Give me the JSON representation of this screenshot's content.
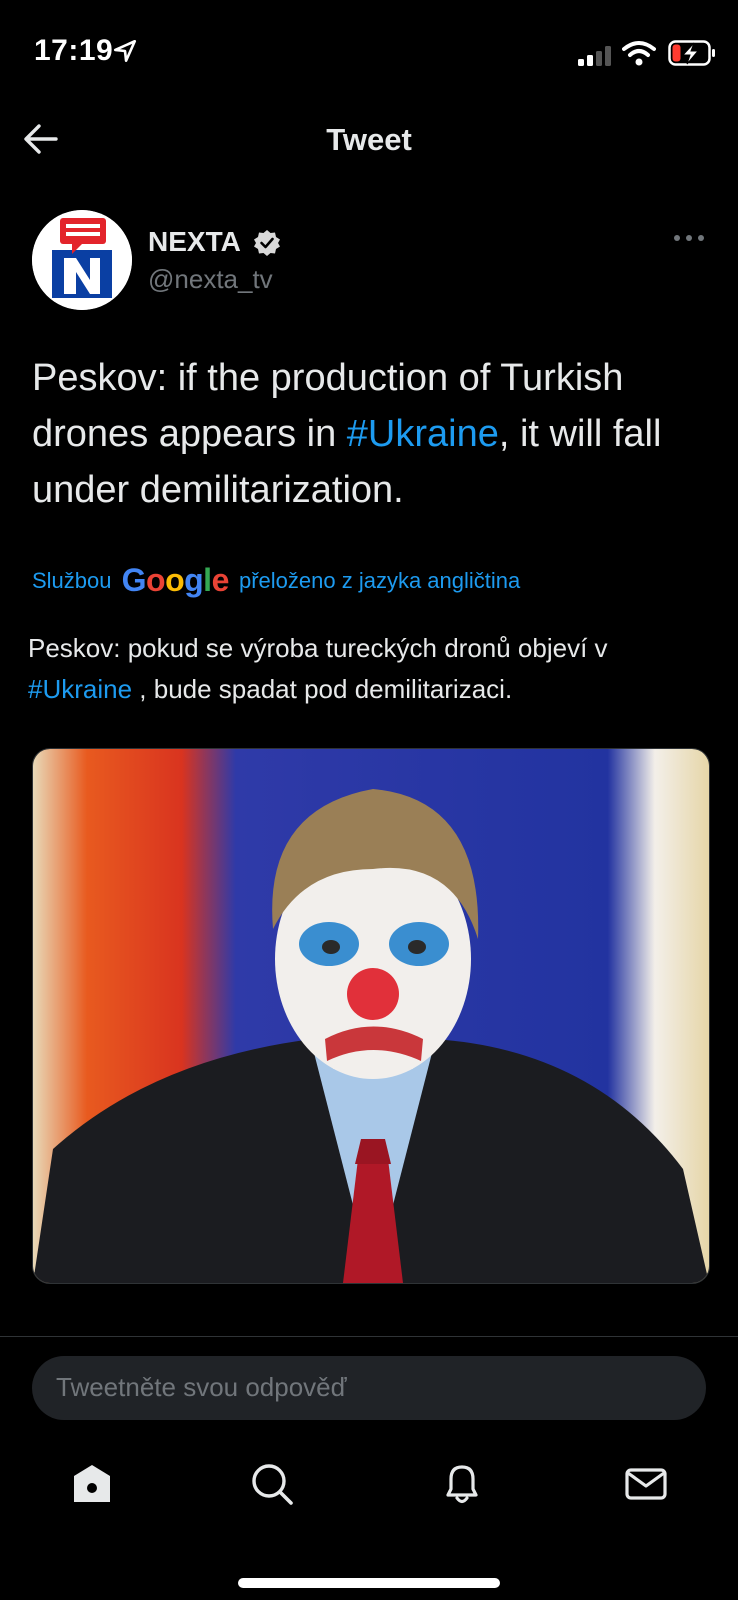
{
  "status_bar": {
    "time": "17:19"
  },
  "header": {
    "title": "Tweet"
  },
  "author": {
    "name": "NEXTA",
    "handle": "@nexta_tv"
  },
  "tweet": {
    "text_before": "Peskov: if the production of Turkish drones appears in ",
    "hashtag": "#Ukraine",
    "text_after": ", it will fall under demilitarization."
  },
  "translation": {
    "prefix": "Službou",
    "logo": "Google",
    "suffix": "přeloženo z jazyka angličtina",
    "text_before": "Peskov: pokud se výroba tureckých dronů objeví v ",
    "hashtag": "#Ukraine",
    "text_after": " , bude spadat pod demilitarizaci."
  },
  "reply": {
    "placeholder": "Tweetněte svou odpověď"
  },
  "tabs": [
    {
      "icon": "home-icon"
    },
    {
      "icon": "search-icon"
    },
    {
      "icon": "bell-icon"
    },
    {
      "icon": "mail-icon"
    }
  ],
  "colors": {
    "accent": "#1d9bf0",
    "background": "#000000",
    "secondary_text": "#71767b"
  }
}
